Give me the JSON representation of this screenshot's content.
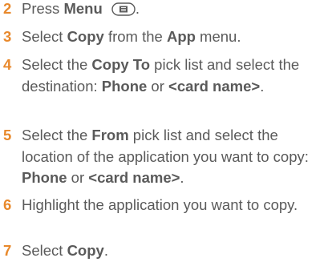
{
  "steps": [
    {
      "number": "2",
      "parts": [
        {
          "t": "Press ",
          "b": false
        },
        {
          "t": "Menu",
          "b": true
        },
        {
          "t": " ",
          "b": false
        },
        {
          "icon": "menu-key-icon"
        },
        {
          "t": ".",
          "b": false
        }
      ]
    },
    {
      "number": "3",
      "parts": [
        {
          "t": "Select ",
          "b": false
        },
        {
          "t": "Copy",
          "b": true
        },
        {
          "t": " from the ",
          "b": false
        },
        {
          "t": "App",
          "b": true
        },
        {
          "t": " menu.",
          "b": false
        }
      ]
    },
    {
      "number": "4",
      "parts": [
        {
          "t": "Select the ",
          "b": false
        },
        {
          "t": "Copy To",
          "b": true
        },
        {
          "t": " pick list and select the destination: ",
          "b": false
        },
        {
          "t": "Phone",
          "b": true
        },
        {
          "t": " or ",
          "b": false
        },
        {
          "t": "<card name>",
          "b": true
        },
        {
          "t": ".",
          "b": false
        }
      ]
    },
    {
      "number": "5",
      "parts": [
        {
          "t": "Select the ",
          "b": false
        },
        {
          "t": "From",
          "b": true
        },
        {
          "t": " pick list and select the location of the application you want to copy: ",
          "b": false
        },
        {
          "t": "Phone",
          "b": true
        },
        {
          "t": " or ",
          "b": false
        },
        {
          "t": "<card name>",
          "b": true
        },
        {
          "t": ".",
          "b": false
        }
      ]
    },
    {
      "number": "6",
      "parts": [
        {
          "t": "Highlight the application you want to copy.",
          "b": false
        }
      ]
    },
    {
      "number": "7",
      "parts": [
        {
          "t": "Select ",
          "b": false
        },
        {
          "t": "Copy",
          "b": true
        },
        {
          "t": ".",
          "b": false
        }
      ]
    }
  ],
  "colors": {
    "step_number": "#e8892c",
    "body_text": "#5a5a5a"
  }
}
